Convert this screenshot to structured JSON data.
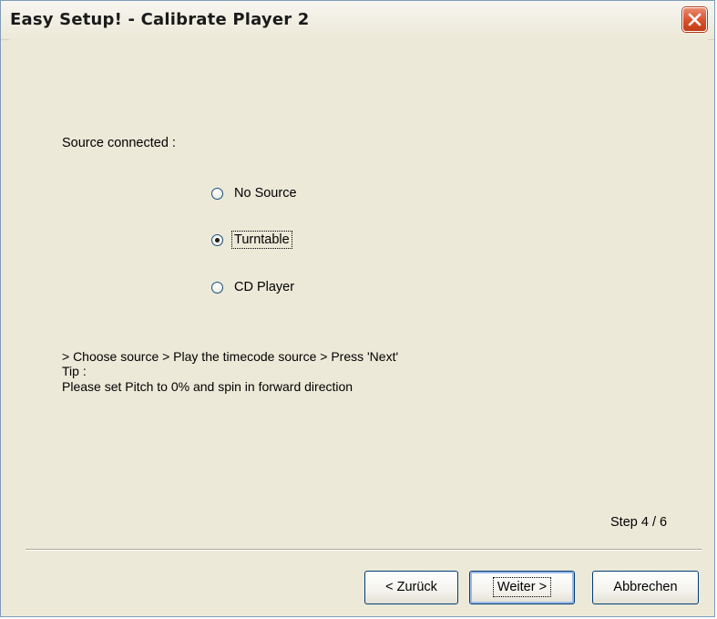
{
  "window": {
    "title": "Easy Setup! - Calibrate Player 2",
    "close_icon": "close-icon"
  },
  "source": {
    "label": "Source connected :",
    "options": [
      {
        "label": "No Source",
        "selected": false
      },
      {
        "label": "Turntable",
        "selected": true
      },
      {
        "label": "CD Player",
        "selected": false
      }
    ]
  },
  "instructions": {
    "line1": "> Choose source > Play the timecode source > Press 'Next'",
    "line2": "Tip :",
    "line3": "Please set Pitch to 0% and spin in forward direction"
  },
  "step": "Step 4 / 6",
  "buttons": {
    "back_label": "< Zurück",
    "next_label": "Weiter >",
    "cancel_label": "Abbrechen"
  },
  "colors": {
    "dialog_bg": "#ece9d8",
    "close_button": "#d9502b",
    "button_border": "#003c74"
  }
}
